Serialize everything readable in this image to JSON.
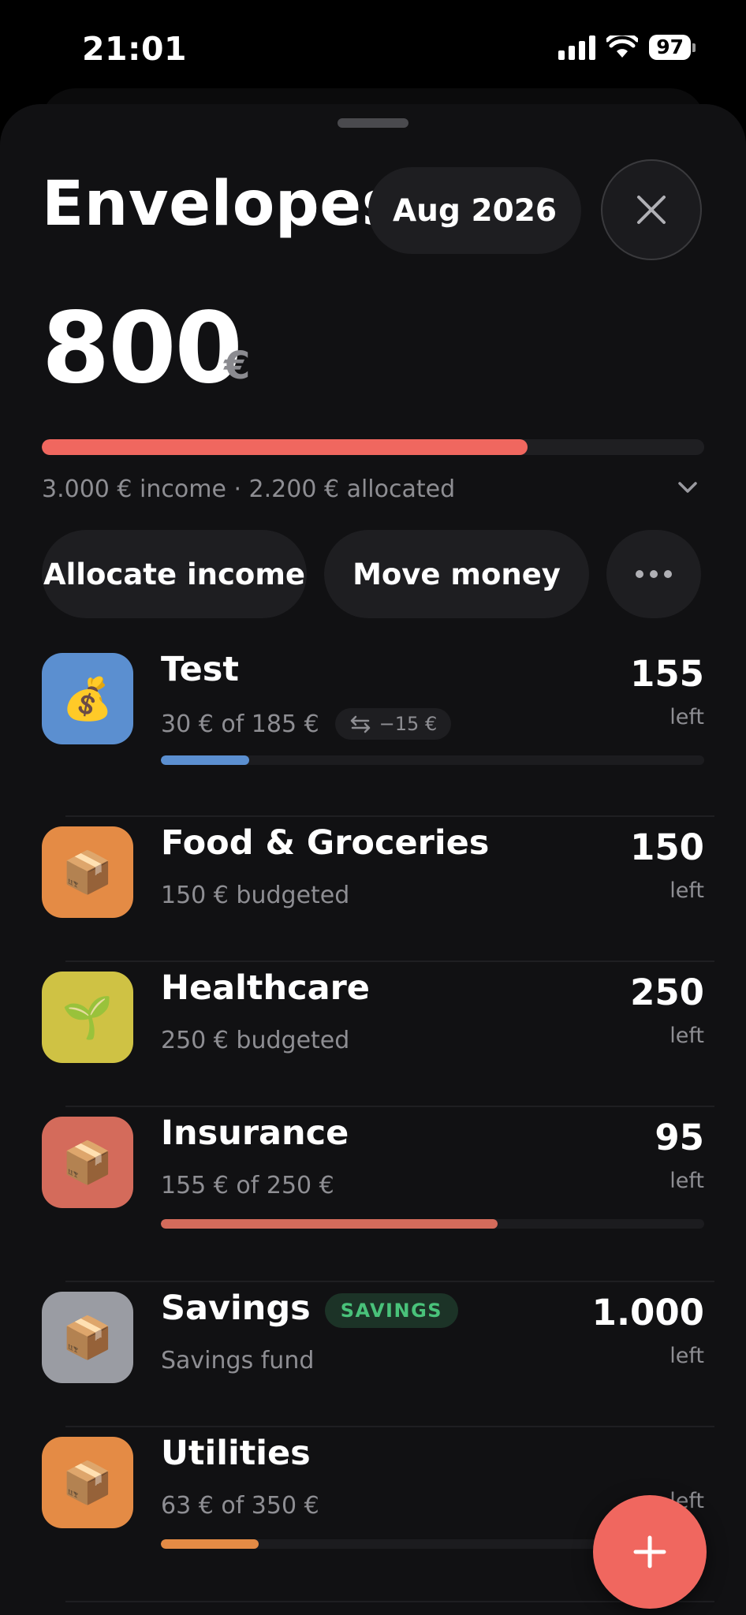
{
  "status_bar": {
    "time": "21:01",
    "battery": "97"
  },
  "header": {
    "title": "Envelopes",
    "month": "Aug 2026",
    "close_icon": "close-icon"
  },
  "summary": {
    "amount": "800",
    "currency": "€",
    "allocated_fraction": 0.733,
    "details": "3.000 € income · 2.200 € allocated"
  },
  "actions": {
    "allocate_label": "Allocate income",
    "move_label": "Move money",
    "more_icon": "ellipsis-icon"
  },
  "envelopes": [
    {
      "name": "Test",
      "icon": "money-bag-icon",
      "emoji": "💰",
      "color": "#5b8fd0",
      "sub": "30 € of 185 €",
      "transfer": "−15 €",
      "amount": "155",
      "left": "left",
      "progress": 0.162,
      "bar_color": "#5b8fd0"
    },
    {
      "name": "Food & Groceries",
      "icon": "package-icon",
      "emoji": "📦",
      "color": "#e48b45",
      "sub": "150 € budgeted",
      "amount": "150",
      "left": "left"
    },
    {
      "name": "Healthcare",
      "icon": "seedling-icon",
      "emoji": "🌱",
      "color": "#cfc244",
      "sub": "250 € budgeted",
      "amount": "250",
      "left": "left"
    },
    {
      "name": "Insurance",
      "icon": "package-icon",
      "emoji": "📦",
      "color": "#d46b5b",
      "sub": "155 € of 250 €",
      "amount": "95",
      "left": "left",
      "progress": 0.62,
      "bar_color": "#d46b5b"
    },
    {
      "name": "Savings",
      "icon": "package-icon",
      "emoji": "📦",
      "color": "#9a9ca3",
      "badge": "SAVINGS",
      "sub": "Savings fund",
      "amount": "1.000",
      "left": "left"
    },
    {
      "name": "Utilities",
      "icon": "package-icon",
      "emoji": "📦",
      "color": "#e48b45",
      "sub": "63 € of 350 €",
      "amount": "",
      "left": "left",
      "progress": 0.18,
      "bar_color": "#e48b45"
    }
  ],
  "fab_icon": "plus-icon"
}
